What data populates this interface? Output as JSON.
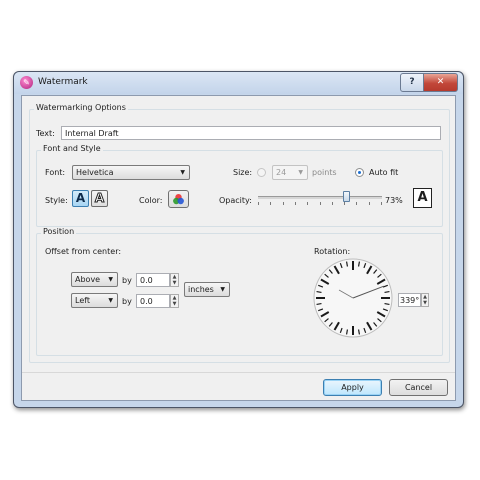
{
  "window": {
    "title": "Watermark",
    "help_label": "?",
    "close_label": "✕"
  },
  "options": {
    "group_label": "Watermarking Options",
    "text_label": "Text:",
    "text_value": "Internal Draft"
  },
  "font_style": {
    "group_label": "Font and Style",
    "font_label": "Font:",
    "font_value": "Helvetica",
    "size_label": "Size:",
    "size_value": "24",
    "size_unit": "points",
    "autofit_label": "Auto fit",
    "autofit_selected": true,
    "style_label": "Style:",
    "style_filled_glyph": "A",
    "style_outline_glyph": "A",
    "color_label": "Color:",
    "opacity_label": "Opacity:",
    "opacity_value": "73%",
    "opacity_fraction": 0.73,
    "preview_glyph": "A"
  },
  "position": {
    "group_label": "Position",
    "offset_label": "Offset from center:",
    "h_align": "Above",
    "h_by_label": "by",
    "h_value": "0.0",
    "v_align": "Left",
    "v_by_label": "by",
    "v_value": "0.0",
    "units": "inches",
    "rotation_label": "Rotation:",
    "rotation_value": "339°",
    "rotation_degrees": 339
  },
  "buttons": {
    "apply": "Apply",
    "cancel": "Cancel"
  },
  "colors": {
    "accent": "#1e6fd0",
    "title_bar": "#c6d6ea",
    "close": "#c2473a"
  }
}
